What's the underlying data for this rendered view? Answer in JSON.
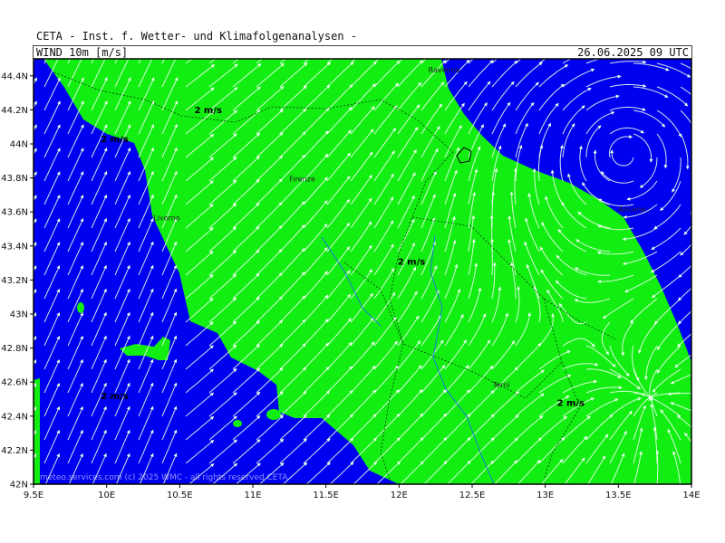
{
  "header": {
    "title": "CETA - Inst. f. Wetter- und Klimafolgenanalysen -",
    "field": "WIND 10m [m/s]",
    "datetime": "26.06.2025 09 UTC"
  },
  "map": {
    "lon_range": [
      9.5,
      14.0
    ],
    "lat_range": [
      42.0,
      44.5
    ],
    "lon_ticks": [
      "9.5E",
      "10E",
      "10.5E",
      "11E",
      "11.5E",
      "12E",
      "12.5E",
      "13E",
      "13.5E",
      "14E"
    ],
    "lat_ticks": [
      "42N",
      "42.2N",
      "42.4N",
      "42.6N",
      "42.8N",
      "43N",
      "43.2N",
      "43.4N",
      "43.6N",
      "43.8N",
      "44N",
      "44.2N",
      "44.4N"
    ],
    "cities": [
      {
        "name": "Ravenna",
        "lon": 12.2,
        "lat": 44.42
      },
      {
        "name": "Firenze",
        "lon": 11.25,
        "lat": 43.78
      },
      {
        "name": "Livorno",
        "lon": 10.32,
        "lat": 43.55
      },
      {
        "name": "Ancona",
        "lon": 13.5,
        "lat": 43.6
      },
      {
        "name": "Terni",
        "lon": 12.64,
        "lat": 42.57
      }
    ],
    "speed_labels": [
      {
        "text": "2 m/s",
        "lon": 10.6,
        "lat": 44.18
      },
      {
        "text": "2 m/s",
        "lon": 9.96,
        "lat": 44.01
      },
      {
        "text": "2 m/s",
        "lon": 11.99,
        "lat": 43.29
      },
      {
        "text": "2 m/s",
        "lon": 13.08,
        "lat": 42.46
      },
      {
        "text": "2 m/s",
        "lon": 9.96,
        "lat": 42.5
      }
    ],
    "colors": {
      "sea": "#0000f0",
      "land": "#12ee12",
      "streamline": "#e8ffe8",
      "border": "#000000",
      "river": "#1e64ff"
    }
  },
  "watermark": "meteo.services.com  (c) 2025 WMC - all rights reserved  CETA"
}
